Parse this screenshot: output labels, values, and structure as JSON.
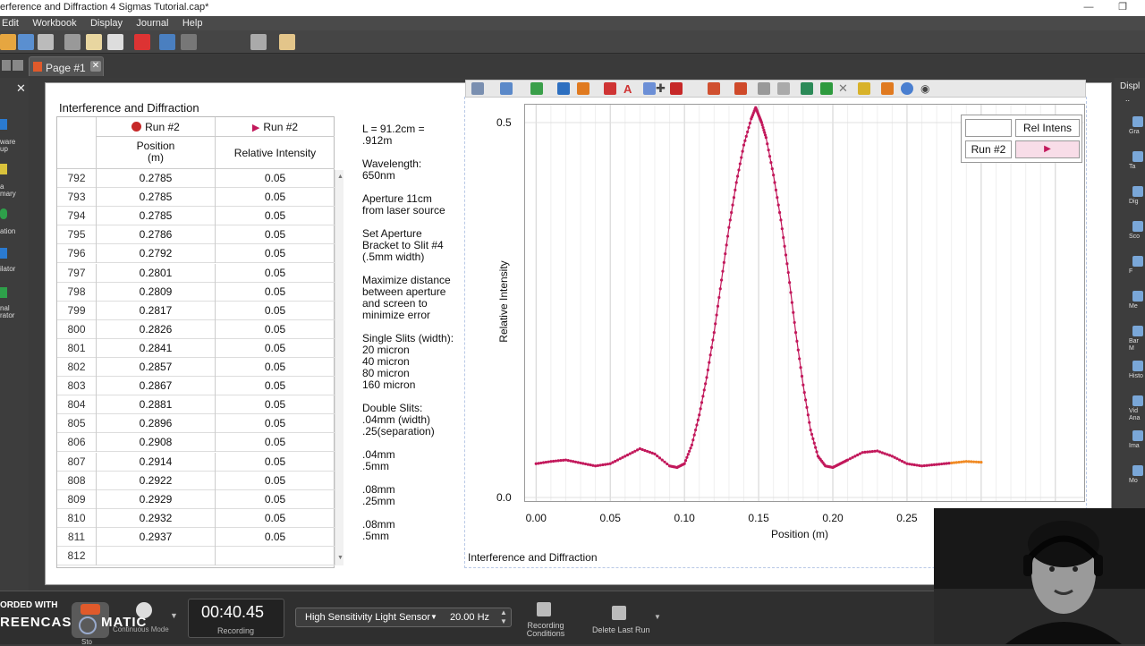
{
  "window": {
    "title": "erference and Diffraction 4 Sigmas Tutorial.cap*",
    "min_icon": "minimize-icon",
    "restore_icon": "restore-icon"
  },
  "menu": [
    "Edit",
    "Workbook",
    "Display",
    "Journal",
    "Help"
  ],
  "tab": {
    "label": "Page #1"
  },
  "left_rail": {
    "labels": [
      "ware\nup",
      "a\nmary",
      "ation",
      "ilator",
      "nal\nrator"
    ]
  },
  "right_rail": {
    "header": "Displ",
    "labels": [
      "Gra",
      "Ta",
      "Dig",
      "Sco",
      "F",
      "Me",
      "Bar M",
      "Histo",
      "Vid\nAna",
      "Ima",
      "Mo"
    ]
  },
  "table": {
    "title": "Interference and Diffraction",
    "run_col1": "Run #2",
    "run_col2": "Run #2",
    "col1_header": "Position\n(m)",
    "col2_header": "Relative Intensity",
    "rows": [
      [
        "792",
        "0.2785",
        "0.05"
      ],
      [
        "793",
        "0.2785",
        "0.05"
      ],
      [
        "794",
        "0.2785",
        "0.05"
      ],
      [
        "795",
        "0.2786",
        "0.05"
      ],
      [
        "796",
        "0.2792",
        "0.05"
      ],
      [
        "797",
        "0.2801",
        "0.05"
      ],
      [
        "798",
        "0.2809",
        "0.05"
      ],
      [
        "799",
        "0.2817",
        "0.05"
      ],
      [
        "800",
        "0.2826",
        "0.05"
      ],
      [
        "801",
        "0.2841",
        "0.05"
      ],
      [
        "802",
        "0.2857",
        "0.05"
      ],
      [
        "803",
        "0.2867",
        "0.05"
      ],
      [
        "804",
        "0.2881",
        "0.05"
      ],
      [
        "805",
        "0.2896",
        "0.05"
      ],
      [
        "806",
        "0.2908",
        "0.05"
      ],
      [
        "807",
        "0.2914",
        "0.05"
      ],
      [
        "808",
        "0.2922",
        "0.05"
      ],
      [
        "809",
        "0.2929",
        "0.05"
      ],
      [
        "810",
        "0.2932",
        "0.05"
      ],
      [
        "811",
        "0.2937",
        "0.05"
      ],
      [
        "812",
        "",
        ""
      ]
    ]
  },
  "notes": [
    "L = 91.2cm =\n.912m",
    "Wavelength:\n650nm",
    "Aperture 11cm\nfrom laser source",
    "Set Aperture\nBracket to Slit #4\n(.5mm width)",
    "Maximize distance\nbetween aperture\nand screen to\nminimize error",
    "Single Slits (width):\n20 micron\n40 micron\n80 micron\n160 micron",
    "Double Slits:\n.04mm (width)\n.25(separation)",
    ".04mm\n.5mm",
    ".08mm\n.25mm",
    ".08mm\n.5mm"
  ],
  "graph": {
    "caption": "Interference and Diffraction",
    "legend_header": "Rel Intens",
    "legend_run": "Run #2",
    "series_color": "#c2185b",
    "tail_color": "#f08a24"
  },
  "chart_data": {
    "type": "scatter",
    "xlabel": "Position (m)",
    "ylabel": "Relative Intensity",
    "xlim": [
      -0.008,
      0.37
    ],
    "ylim": [
      -0.006,
      0.525
    ],
    "x_ticks": [
      "0.00",
      "0.05",
      "0.10",
      "0.15",
      "0.20",
      "0.25"
    ],
    "y_ticks": [
      "0.0",
      "0.5"
    ],
    "series": [
      {
        "name": "Run #2",
        "x": [
          0.0,
          0.01,
          0.02,
          0.03,
          0.04,
          0.05,
          0.06,
          0.07,
          0.08,
          0.09,
          0.095,
          0.1,
          0.105,
          0.11,
          0.115,
          0.12,
          0.125,
          0.13,
          0.135,
          0.14,
          0.145,
          0.148,
          0.15,
          0.152,
          0.155,
          0.16,
          0.165,
          0.17,
          0.175,
          0.18,
          0.185,
          0.19,
          0.195,
          0.2,
          0.205,
          0.21,
          0.22,
          0.23,
          0.24,
          0.25,
          0.26,
          0.27,
          0.28
        ],
        "y": [
          0.045,
          0.048,
          0.05,
          0.046,
          0.042,
          0.045,
          0.055,
          0.065,
          0.058,
          0.042,
          0.04,
          0.045,
          0.07,
          0.11,
          0.16,
          0.22,
          0.29,
          0.36,
          0.42,
          0.47,
          0.505,
          0.52,
          0.51,
          0.5,
          0.48,
          0.43,
          0.37,
          0.3,
          0.22,
          0.15,
          0.09,
          0.055,
          0.042,
          0.04,
          0.045,
          0.05,
          0.06,
          0.062,
          0.055,
          0.045,
          0.042,
          0.044,
          0.046
        ]
      },
      {
        "name": "Run #2 (tail)",
        "x": [
          0.28,
          0.29,
          0.3
        ],
        "y": [
          0.046,
          0.048,
          0.047
        ]
      }
    ]
  },
  "bottom": {
    "recorded_with": "ORDED WITH",
    "screencast": "REENCAST",
    "matic": "MATIC",
    "mode_label": "Continuous Mode",
    "stop_label": "Sto",
    "timer": "00:40.45",
    "recording": "Recording",
    "sensor": "High Sensitivity Light Sensor",
    "rate": "20.00 Hz",
    "recording_conditions": "Recording\nConditions",
    "delete_last_run": "Delete Last Run"
  }
}
